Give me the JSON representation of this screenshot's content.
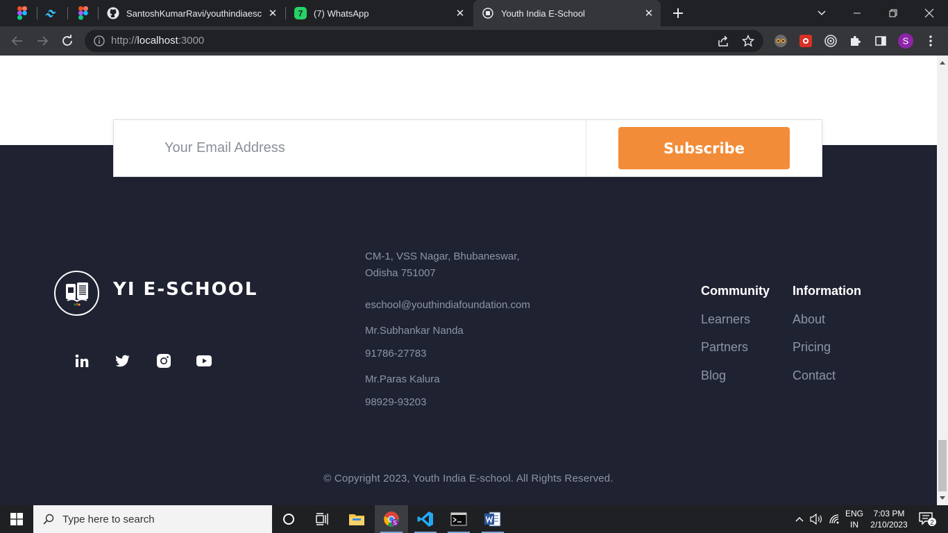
{
  "browser": {
    "tabs": [
      {
        "title": "SantoshKumarRavi/youthindiaesc",
        "icon": "github-icon"
      },
      {
        "title": "(7) WhatsApp",
        "icon": "whatsapp-icon",
        "badge": "7"
      },
      {
        "title": "Youth India E-School",
        "icon": "site-favicon",
        "active": true
      }
    ],
    "url_scheme": "http://",
    "url_host": "localhost",
    "url_port": ":3000",
    "profile_initial": "S"
  },
  "subscribe": {
    "email_placeholder": "Your Email Address",
    "button_label": "Subscribe"
  },
  "footer": {
    "brand": "YI E-SCHOOL",
    "social": [
      "linkedin-icon",
      "twitter-icon",
      "instagram-icon",
      "youtube-icon"
    ],
    "contact": {
      "address_line1": "CM-1, VSS Nagar, Bhubaneswar,",
      "address_line2": "Odisha 751007",
      "email": "eschool@youthindiafoundation.com",
      "person1_name": "Mr.Subhankar Nanda",
      "person1_phone": "91786-27783",
      "person2_name": "Mr.Paras Kalura",
      "person2_phone": "98929-93203"
    },
    "columns": [
      {
        "heading": "Community",
        "links": [
          "Learners",
          "Partners",
          "Blog"
        ]
      },
      {
        "heading": "Information",
        "links": [
          "About",
          "Pricing",
          "Contact"
        ]
      }
    ],
    "copyright": "© Copyright 2023, Youth India E-school. All Rights Reserved."
  },
  "taskbar": {
    "search_placeholder": "Type here to search",
    "language_line1": "ENG",
    "language_line2": "IN",
    "time": "7:03 PM",
    "date": "2/10/2023",
    "notification_count": "2"
  },
  "colors": {
    "footer_bg": "#1f2231",
    "accent_orange": "#f28c38",
    "muted_text": "#8d95a8"
  }
}
